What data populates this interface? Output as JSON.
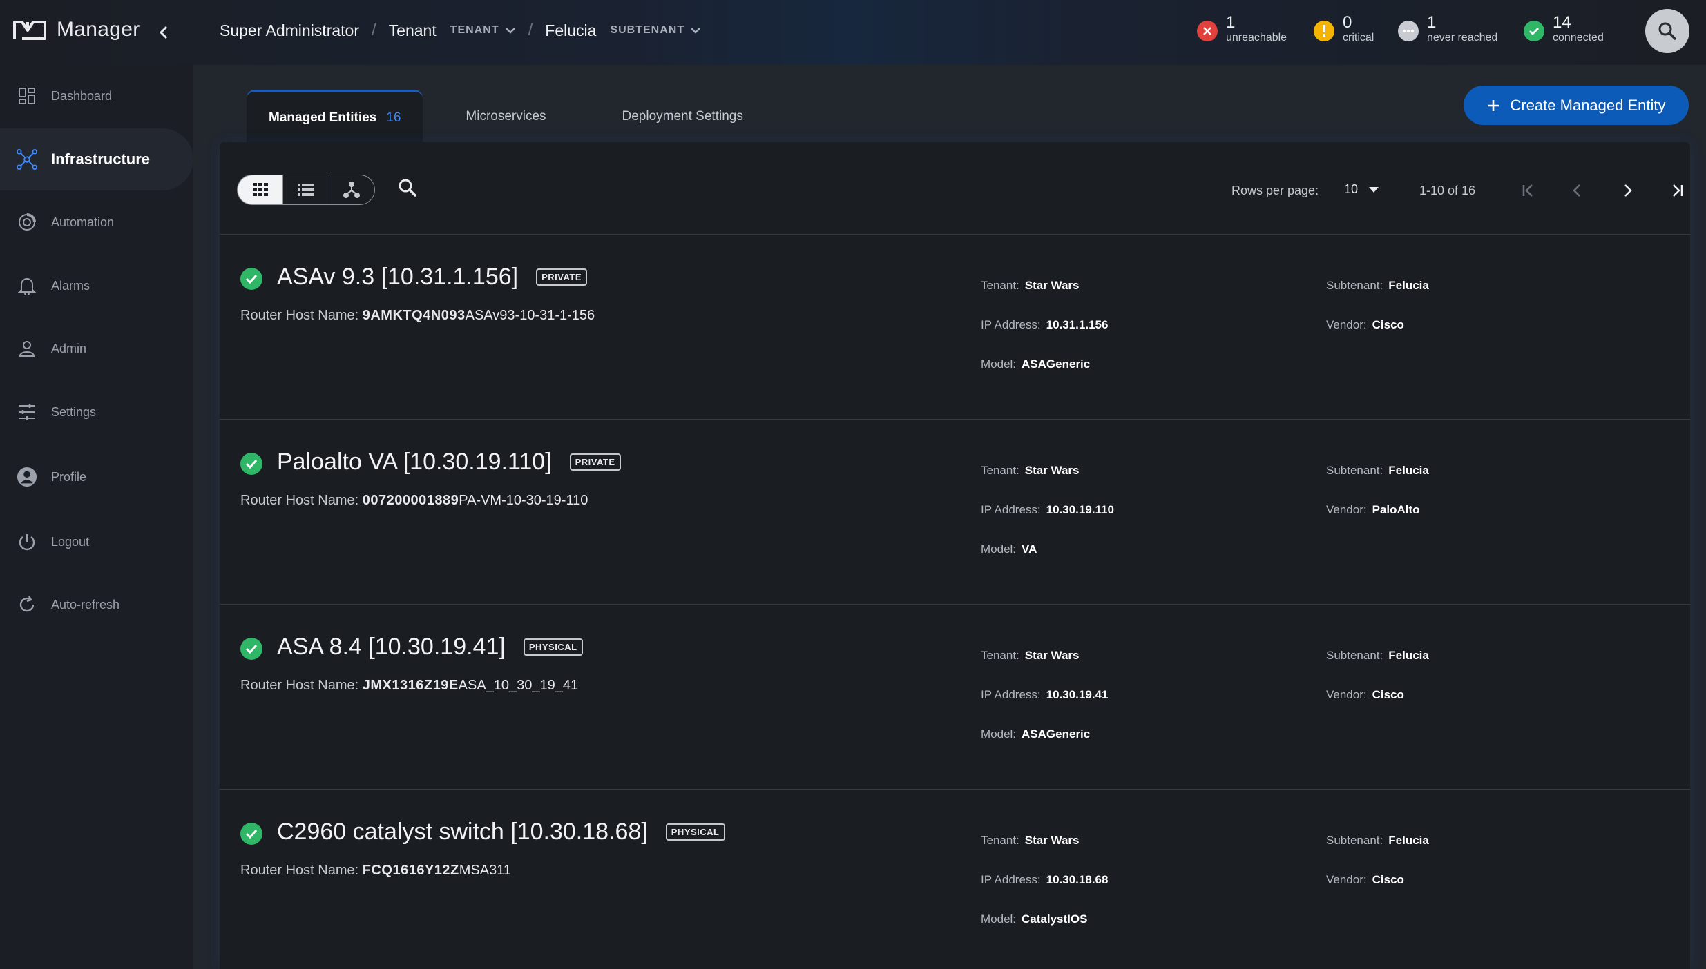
{
  "app": {
    "name": "Manager"
  },
  "breadcrumb": {
    "root": "Super Administrator",
    "tenant_label": "Tenant",
    "tenant_tag": "TENANT",
    "subtenant_label": "Felucia",
    "subtenant_tag": "SUBTENANT"
  },
  "status": {
    "unreachable": {
      "count": "1",
      "label": "unreachable",
      "color": "#e0413a"
    },
    "critical": {
      "count": "0",
      "label": "critical",
      "color": "#f5b400"
    },
    "never_reached": {
      "count": "1",
      "label": "never reached",
      "color": "#c8ccd2"
    },
    "connected": {
      "count": "14",
      "label": "connected",
      "color": "#2fb667"
    }
  },
  "sidebar": {
    "items": [
      {
        "label": "Dashboard",
        "icon": "dashboard-icon"
      },
      {
        "label": "Infrastructure",
        "icon": "network-icon",
        "active": true
      },
      {
        "label": "Automation",
        "icon": "automation-icon"
      },
      {
        "label": "Alarms",
        "icon": "bell-icon"
      },
      {
        "label": "Admin",
        "icon": "user-icon"
      },
      {
        "label": "Settings",
        "icon": "sliders-icon"
      },
      {
        "label": "Profile",
        "icon": "profile-icon"
      },
      {
        "label": "Logout",
        "icon": "power-icon"
      },
      {
        "label": "Auto-refresh",
        "icon": "refresh-icon"
      }
    ]
  },
  "tabs": {
    "managed_entities": "Managed Entities",
    "managed_entities_count": "16",
    "microservices": "Microservices",
    "deployment_settings": "Deployment Settings"
  },
  "create_button": "Create Managed Entity",
  "pagination": {
    "rows_label": "Rows per page:",
    "rows_value": "10",
    "range": "1-10 of 16"
  },
  "labels": {
    "host": "Router Host Name:",
    "tenant": "Tenant:",
    "subtenant": "Subtenant:",
    "ip": "IP Address:",
    "vendor": "Vendor:",
    "model": "Model:"
  },
  "entities": [
    {
      "title": "ASAv 9.3 [10.31.1.156]",
      "badge": "PRIVATE",
      "host_id": "9AMKTQ4N093",
      "host_name": "ASAv93-10-31-1-156",
      "tenant": "Star Wars",
      "subtenant": "Felucia",
      "ip": "10.31.1.156",
      "vendor": "Cisco",
      "model": "ASAGeneric"
    },
    {
      "title": "Paloalto VA [10.30.19.110]",
      "badge": "PRIVATE",
      "host_id": "007200001889",
      "host_name": "PA-VM-10-30-19-110",
      "tenant": "Star Wars",
      "subtenant": "Felucia",
      "ip": "10.30.19.110",
      "vendor": "PaloAlto",
      "model": "VA"
    },
    {
      "title": "ASA 8.4 [10.30.19.41]",
      "badge": "PHYSICAL",
      "host_id": "JMX1316Z19E",
      "host_name": "ASA_10_30_19_41",
      "tenant": "Star Wars",
      "subtenant": "Felucia",
      "ip": "10.30.19.41",
      "vendor": "Cisco",
      "model": "ASAGeneric"
    },
    {
      "title": "C2960 catalyst switch [10.30.18.68]",
      "badge": "PHYSICAL",
      "host_id": "FCQ1616Y12Z",
      "host_name": "MSA311",
      "tenant": "Star Wars",
      "subtenant": "Felucia",
      "ip": "10.30.18.68",
      "vendor": "Cisco",
      "model": "CatalystIOS"
    }
  ]
}
